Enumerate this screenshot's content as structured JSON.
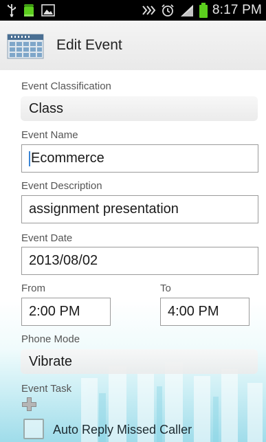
{
  "status_bar": {
    "time": "8:17 PM",
    "icons": [
      "usb-icon",
      "android-icon",
      "image-icon",
      "nfc-icon",
      "alarm-icon",
      "signal-icon",
      "battery-icon"
    ]
  },
  "action_bar": {
    "title": "Edit Event",
    "icon": "calendar-app-icon"
  },
  "form": {
    "classification": {
      "label": "Event Classification",
      "value": "Class"
    },
    "name": {
      "label": "Event Name",
      "value": "Ecommerce"
    },
    "description": {
      "label": "Event Description",
      "value": "assignment presentation"
    },
    "date": {
      "label": "Event Date",
      "value": "2013/08/02"
    },
    "from": {
      "label": "From",
      "value": "2:00 PM"
    },
    "to": {
      "label": "To",
      "value": "4:00 PM"
    },
    "phone_mode": {
      "label": "Phone Mode",
      "value": "Vibrate"
    },
    "task": {
      "label": "Event Task",
      "add_icon": "plus-icon"
    },
    "auto_reply": {
      "label": "Auto Reply Missed Caller",
      "checked": false
    }
  },
  "colors": {
    "status_bar_bg": "#000000",
    "battery_green": "#5ccf1e",
    "accent_blue": "#3b86d6",
    "bottom_cyan": "#9fdcea"
  }
}
